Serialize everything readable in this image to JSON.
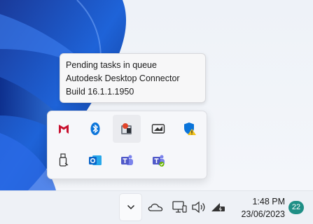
{
  "tooltip": {
    "line1": "Pending tasks in queue",
    "line2": "Autodesk Desktop Connector",
    "line3": "Build 16.1.1.1950"
  },
  "tray_overflow": {
    "icons": [
      {
        "name": "mcafee-icon",
        "color": "#c8102e"
      },
      {
        "name": "bluetooth-icon",
        "color": "#0a74da"
      },
      {
        "name": "autodesk-desktop-connector-icon",
        "color": "#e0442a",
        "hovered": true
      },
      {
        "name": "usb-drive-icon",
        "color": "#333333"
      },
      {
        "name": "windows-security-warning-icon",
        "color": "#0a74da"
      },
      {
        "name": "safely-remove-hardware-icon",
        "color": "#333333"
      },
      {
        "name": "outlook-icon",
        "color": "#0a64c8"
      },
      {
        "name": "teams-icon",
        "color": "#5059c9"
      },
      {
        "name": "teams-status-icon",
        "color": "#5059c9"
      }
    ]
  },
  "taskbar": {
    "time": "1:48 PM",
    "date": "23/06/2023",
    "notification_count": "22",
    "accent": "#1f8f86"
  }
}
